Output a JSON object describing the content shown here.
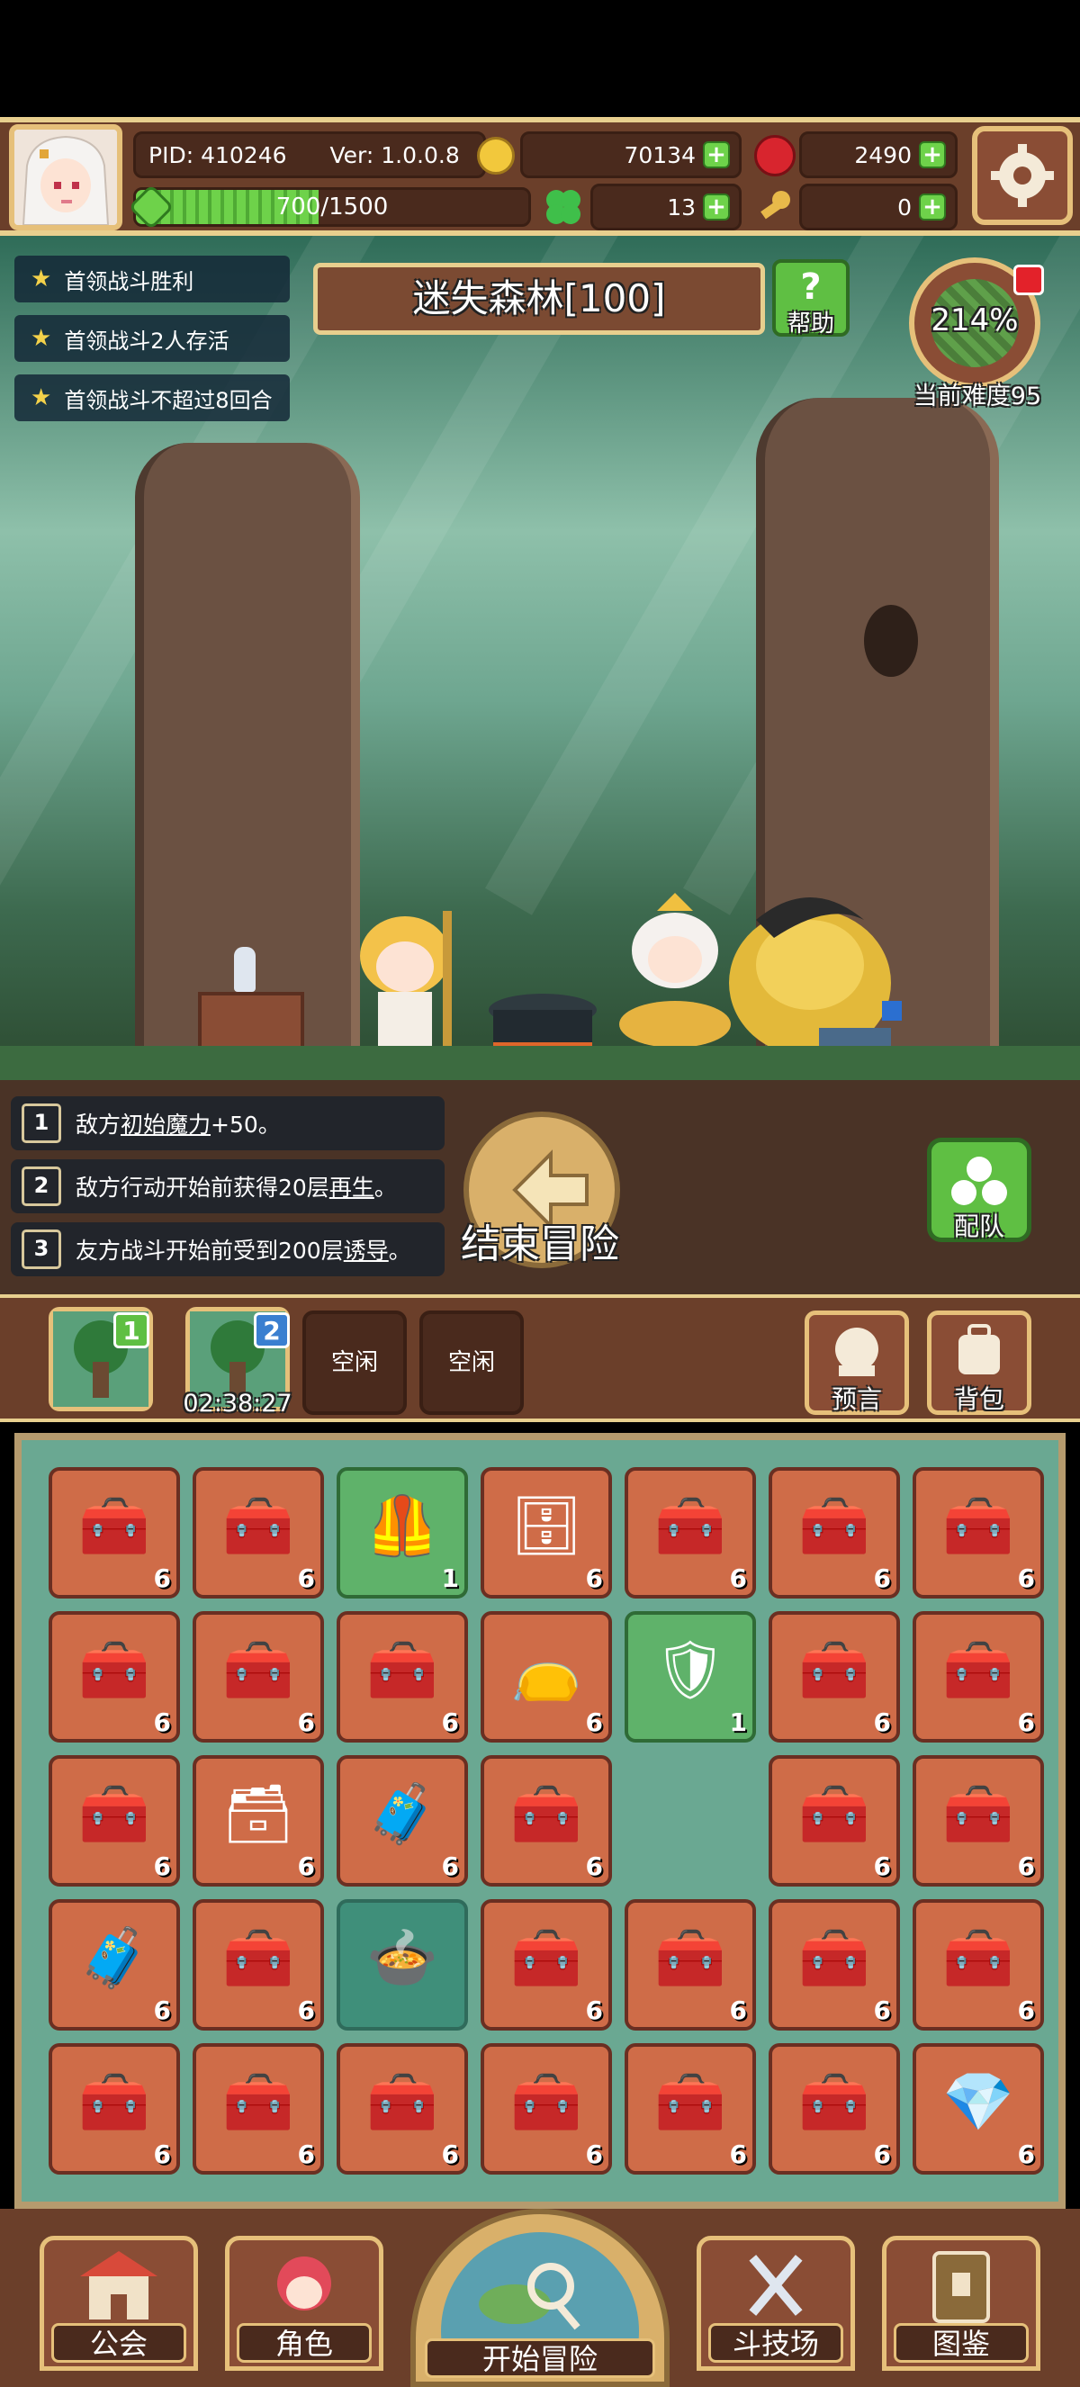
{
  "header": {
    "pid_label": "PID: 410246",
    "version_label": "Ver: 1.0.0.8",
    "gold": "70134",
    "gems": "2490",
    "exp_text": "700/1500",
    "exp_progress": 0.4667,
    "clover": "13",
    "keys": "0"
  },
  "goals": [
    "首领战斗胜利",
    "首领战斗2人存活",
    "首领战斗不超过8回合"
  ],
  "stage": {
    "title": "迷失森林[100]",
    "help_label": "帮助",
    "difficulty_percent": "214%",
    "difficulty_label": "当前难度95"
  },
  "effects": [
    {
      "num": "1",
      "pre": "敌方",
      "key": "初始魔力",
      "post": "+50。"
    },
    {
      "num": "2",
      "pre": "敌方行动开始前获得20层",
      "key": "再生",
      "post": "。"
    },
    {
      "num": "3",
      "pre": "友方战斗开始前受到200层",
      "key": "诱导",
      "post": "。"
    }
  ],
  "actions": {
    "end_adventure": "结束冒险",
    "team_label": "配队",
    "prophecy_label": "预言",
    "bag_label": "背包"
  },
  "queue": {
    "slot1_badge": "1",
    "slot2_badge": "2",
    "slot2_timer": "02:38:27",
    "idle_label": "空闲"
  },
  "inventory": {
    "rows": [
      [
        {
          "item": "chest-icon",
          "count": "6"
        },
        {
          "item": "chest-icon",
          "count": "6"
        },
        {
          "item": "armor-icon",
          "count": "1",
          "rare": true
        },
        {
          "item": "iron-chest-icon",
          "count": "6"
        },
        {
          "item": "chest-icon",
          "count": "6"
        },
        {
          "item": "chest-icon",
          "count": "6"
        },
        {
          "item": "chest-icon",
          "count": "6"
        }
      ],
      [
        {
          "item": "chest-icon",
          "count": "6"
        },
        {
          "item": "chest-icon",
          "count": "6"
        },
        {
          "item": "green-chest-icon",
          "count": "6"
        },
        {
          "item": "pouch-icon",
          "count": "6"
        },
        {
          "item": "plate-armor-icon",
          "count": "1",
          "rare": true
        },
        {
          "item": "chest-icon",
          "count": "6"
        },
        {
          "item": "chest-icon",
          "count": "6"
        }
      ],
      [
        {
          "item": "chest-icon",
          "count": "6"
        },
        {
          "item": "dark-chest-icon",
          "count": "6"
        },
        {
          "item": "wood-chest-icon",
          "count": "6"
        },
        {
          "item": "chest-icon",
          "count": "6"
        },
        {
          "item": "empty",
          "count": ""
        },
        {
          "item": "chest-icon",
          "count": "6"
        },
        {
          "item": "chest-icon",
          "count": "6"
        }
      ],
      [
        {
          "item": "wood-chest-icon",
          "count": "6"
        },
        {
          "item": "chest-icon",
          "count": "6"
        },
        {
          "item": "cauldron-icon",
          "count": "",
          "special": true
        },
        {
          "item": "chest-icon",
          "count": "6"
        },
        {
          "item": "chest-icon",
          "count": "6"
        },
        {
          "item": "chest-icon",
          "count": "6"
        },
        {
          "item": "chest-icon",
          "count": "6"
        }
      ],
      [
        {
          "item": "chest-icon",
          "count": "6"
        },
        {
          "item": "chest-icon",
          "count": "6"
        },
        {
          "item": "chest-icon",
          "count": "6"
        },
        {
          "item": "chest-icon",
          "count": "6"
        },
        {
          "item": "flag-chest-icon",
          "count": "6"
        },
        {
          "item": "chest-icon",
          "count": "6"
        },
        {
          "item": "crystal-chest-icon",
          "count": "6"
        }
      ]
    ]
  },
  "nav": {
    "guild": "公会",
    "character": "角色",
    "start_adventure": "开始冒险",
    "arena": "斗技场",
    "codex": "图鉴"
  }
}
